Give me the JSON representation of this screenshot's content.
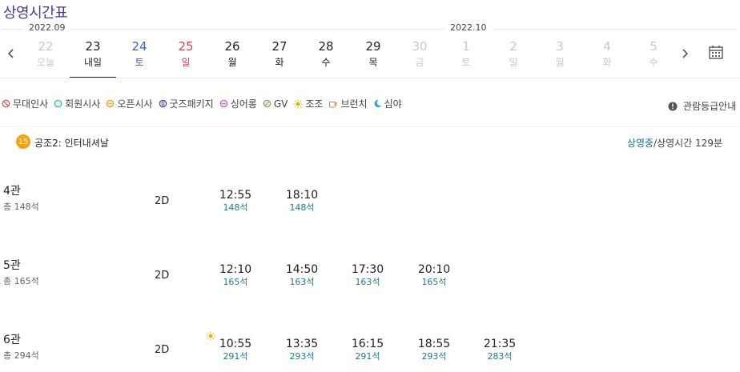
{
  "page_title": "상영시간표",
  "months": {
    "left": "2022.09",
    "right": "2022.10"
  },
  "dates": [
    {
      "num": "22",
      "wd": "오늘",
      "color": "#c8c8c8"
    },
    {
      "num": "23",
      "wd": "내일",
      "color": "#222222",
      "selected": true
    },
    {
      "num": "24",
      "wd": "토",
      "color": "#3b62b8"
    },
    {
      "num": "25",
      "wd": "일",
      "color": "#d9444a"
    },
    {
      "num": "26",
      "wd": "월",
      "color": "#222222"
    },
    {
      "num": "27",
      "wd": "화",
      "color": "#222222"
    },
    {
      "num": "28",
      "wd": "수",
      "color": "#222222"
    },
    {
      "num": "29",
      "wd": "목",
      "color": "#222222"
    },
    {
      "num": "30",
      "wd": "금",
      "color": "#c8c8c8"
    },
    {
      "num": "1",
      "wd": "토",
      "color": "#c8c8c8"
    },
    {
      "num": "2",
      "wd": "일",
      "color": "#c8c8c8"
    },
    {
      "num": "3",
      "wd": "월",
      "color": "#c8c8c8"
    },
    {
      "num": "4",
      "wd": "화",
      "color": "#c8c8c8"
    },
    {
      "num": "5",
      "wd": "수",
      "color": "#c8c8c8"
    }
  ],
  "legend": [
    {
      "label": "무대인사",
      "icon": "prohibit-icon",
      "color": "#e0524f"
    },
    {
      "label": "회원시사",
      "icon": "circle-icon",
      "color": "#44b3a6"
    },
    {
      "label": "오픈시사",
      "icon": "circle-icon",
      "color": "#e8a317"
    },
    {
      "label": "굿즈패키지",
      "icon": "circle-icon",
      "color": "#6a3fa0"
    },
    {
      "label": "싱어롱",
      "icon": "circle-icon",
      "color": "#d45fbe"
    },
    {
      "label": "GV",
      "icon": "circle-icon",
      "color": "#7fa84a"
    },
    {
      "label": "조조",
      "icon": "sun-icon",
      "color": "#f0b400"
    },
    {
      "label": "브런치",
      "icon": "cup-icon",
      "color": "#c98a3a"
    },
    {
      "label": "심야",
      "icon": "moon-icon",
      "color": "#2d9bd6"
    }
  ],
  "rating_guide": "관람등급안내",
  "movie": {
    "age": "15",
    "title": "공조2: 인터내셔날",
    "status_on": "상영중",
    "runtime": "/상영시간 129분"
  },
  "halls": [
    {
      "name": "4관",
      "total": "총 148석",
      "format": "2D",
      "showtimes": [
        {
          "time": "12:55",
          "seats": "148석"
        },
        {
          "time": "18:10",
          "seats": "148석"
        }
      ]
    },
    {
      "name": "5관",
      "total": "총 165석",
      "format": "2D",
      "showtimes": [
        {
          "time": "12:10",
          "seats": "165석"
        },
        {
          "time": "14:50",
          "seats": "163석"
        },
        {
          "time": "17:30",
          "seats": "163석"
        },
        {
          "time": "20:10",
          "seats": "165석"
        }
      ]
    },
    {
      "name": "6관",
      "total": "총 294석",
      "format": "2D",
      "early_icon": "sun-icon",
      "showtimes": [
        {
          "time": "10:55",
          "seats": "291석"
        },
        {
          "time": "13:35",
          "seats": "293석"
        },
        {
          "time": "16:15",
          "seats": "291석"
        },
        {
          "time": "18:55",
          "seats": "293석"
        },
        {
          "time": "21:35",
          "seats": "283석"
        }
      ]
    }
  ]
}
